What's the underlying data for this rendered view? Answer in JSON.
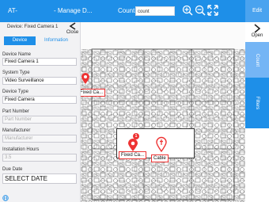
{
  "topbar": {
    "back_label": "AT-",
    "page_title": "- Manage D...",
    "count_label": "Count",
    "count_input_value": "count",
    "edit_label": "Edit"
  },
  "left_panel": {
    "device_title": "Device: Fixed Camera 1",
    "close_label": "Close",
    "tabs": [
      "Device",
      "Information"
    ],
    "fields": [
      {
        "label": "Device Name",
        "value": "Fixed Camera 1",
        "placeholder": ""
      },
      {
        "label": "System Type",
        "value": "Video Surveillance",
        "placeholder": ""
      },
      {
        "label": "Device Type",
        "value": "Fixed Camera",
        "placeholder": ""
      },
      {
        "label": "Part Number",
        "value": "",
        "placeholder": "Part Number"
      },
      {
        "label": "Manufacturer",
        "value": "",
        "placeholder": "Manufacturer"
      },
      {
        "label": "Installation Hours",
        "value": "",
        "placeholder": "3.5"
      },
      {
        "label": "Due Date",
        "value": "SELECT DATE",
        "placeholder": ""
      }
    ]
  },
  "right_rail": {
    "open_label": "Open",
    "count_label": "Count",
    "filters_label": "Filters"
  },
  "plan": {
    "marker_1_label": "Fixed Ca...",
    "marker_2_label": "Fixed Ca...",
    "marker_2_badge": "1",
    "cable_label": "Cable"
  },
  "colors": {
    "accent": "#1e8fe8",
    "rail_light": "#74b5f5",
    "marker": "#e33333"
  },
  "icons": [
    "close-icon",
    "open-icon",
    "zoom-in-icon",
    "zoom-out-icon",
    "fullscreen-icon",
    "globe-icon",
    "map-pin-icon"
  ]
}
